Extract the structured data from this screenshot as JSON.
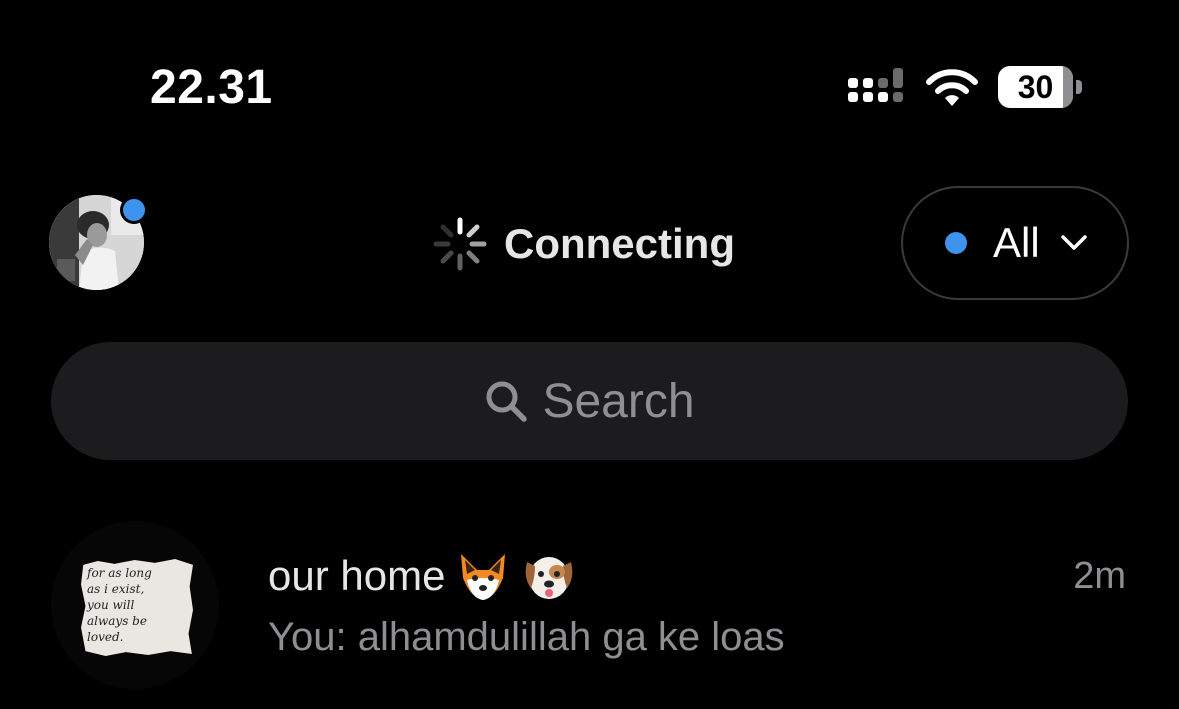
{
  "status_bar": {
    "time": "22.31",
    "battery": "30",
    "signal_icon": "cellular-signal-icon",
    "wifi_icon": "wifi-icon",
    "battery_icon": "battery-icon"
  },
  "header": {
    "avatar_icon": "profile-avatar",
    "connecting_label": "Connecting",
    "spinner_icon": "loading-spinner-icon",
    "filter": {
      "label": "All",
      "icon": "chevron-down-icon",
      "dot_color": "#3f92ee"
    }
  },
  "search": {
    "placeholder": "Search",
    "icon": "search-icon"
  },
  "chats": [
    {
      "title": "our home",
      "emojis": [
        "fox-emoji",
        "dog-emoji"
      ],
      "time": "2m",
      "preview": "You: alhamdulillah ga ke loas",
      "avatar_note_lines": [
        "for as long",
        "as i exist,",
        "you will",
        "always be",
        "loved."
      ]
    }
  ],
  "colors": {
    "background": "#000000",
    "accent_blue": "#3f92ee",
    "secondary_text": "#8e8e93",
    "search_bg": "#1c1c1e"
  }
}
